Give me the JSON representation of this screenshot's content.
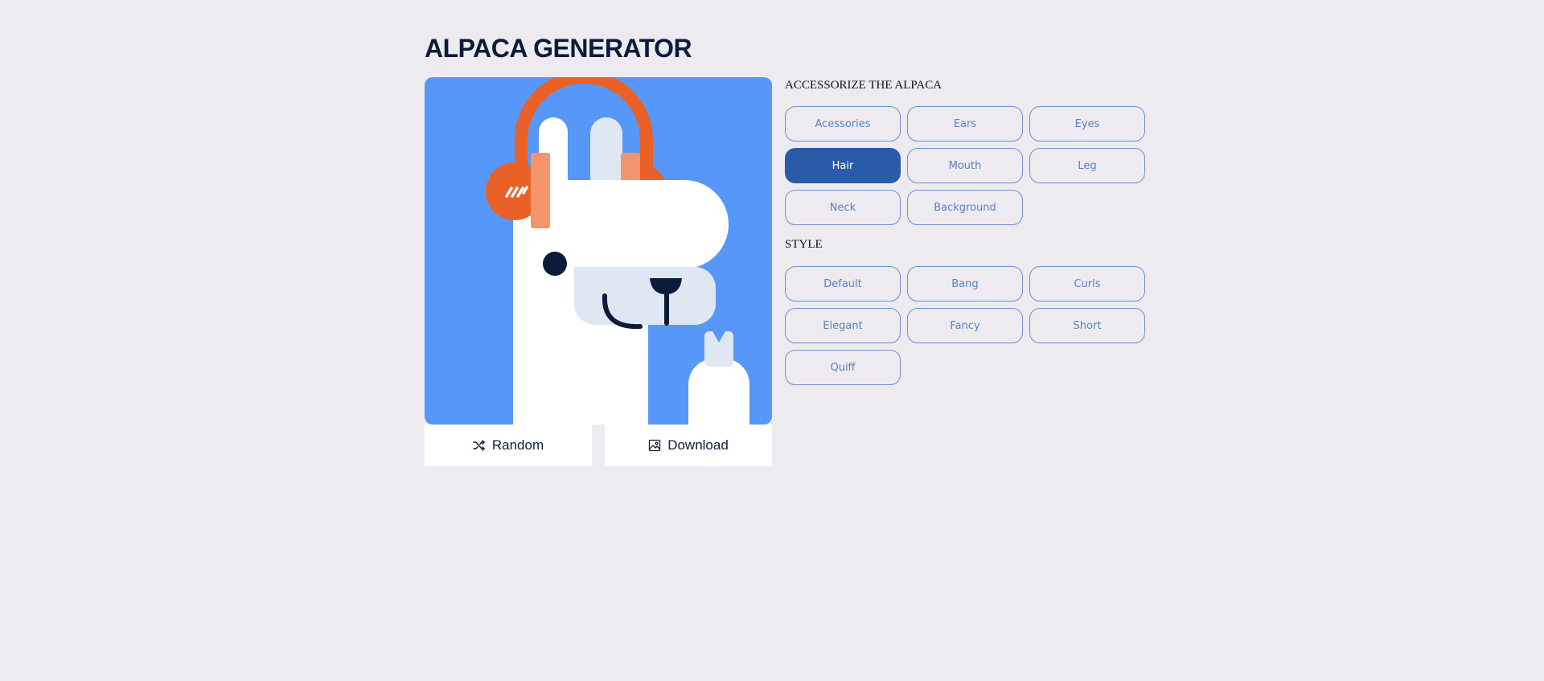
{
  "app": {
    "title": "ALPACA GENERATOR"
  },
  "actions": {
    "random_label": "Random",
    "random_icon": "shuffle-icon",
    "download_label": "Download",
    "download_icon": "image-icon"
  },
  "accessorize": {
    "heading": "ACCESSORIZE THE ALPACA",
    "selected": "Hair",
    "items": [
      {
        "label": "Acessories"
      },
      {
        "label": "Ears"
      },
      {
        "label": "Eyes"
      },
      {
        "label": "Hair"
      },
      {
        "label": "Mouth"
      },
      {
        "label": "Leg"
      },
      {
        "label": "Neck"
      },
      {
        "label": "Background"
      }
    ]
  },
  "style": {
    "heading": "STYLE",
    "items": [
      {
        "label": "Default"
      },
      {
        "label": "Bang"
      },
      {
        "label": "Curls"
      },
      {
        "label": "Elegant"
      },
      {
        "label": "Fancy"
      },
      {
        "label": "Short"
      },
      {
        "label": "Quiff"
      }
    ]
  },
  "colors": {
    "background": "#edebef",
    "title": "#0d1b3a",
    "preview_bg": "#5797f7",
    "headphones": "#e96127",
    "headphone_pad": "#f2956c",
    "alpaca_body": "#ffffff",
    "alpaca_shade": "#dfe7f2",
    "alpaca_dark": "#0d1b3a",
    "option_border": "#6f8fd0",
    "option_text": "#5b7fc4",
    "option_active": "#2a5ba8"
  }
}
